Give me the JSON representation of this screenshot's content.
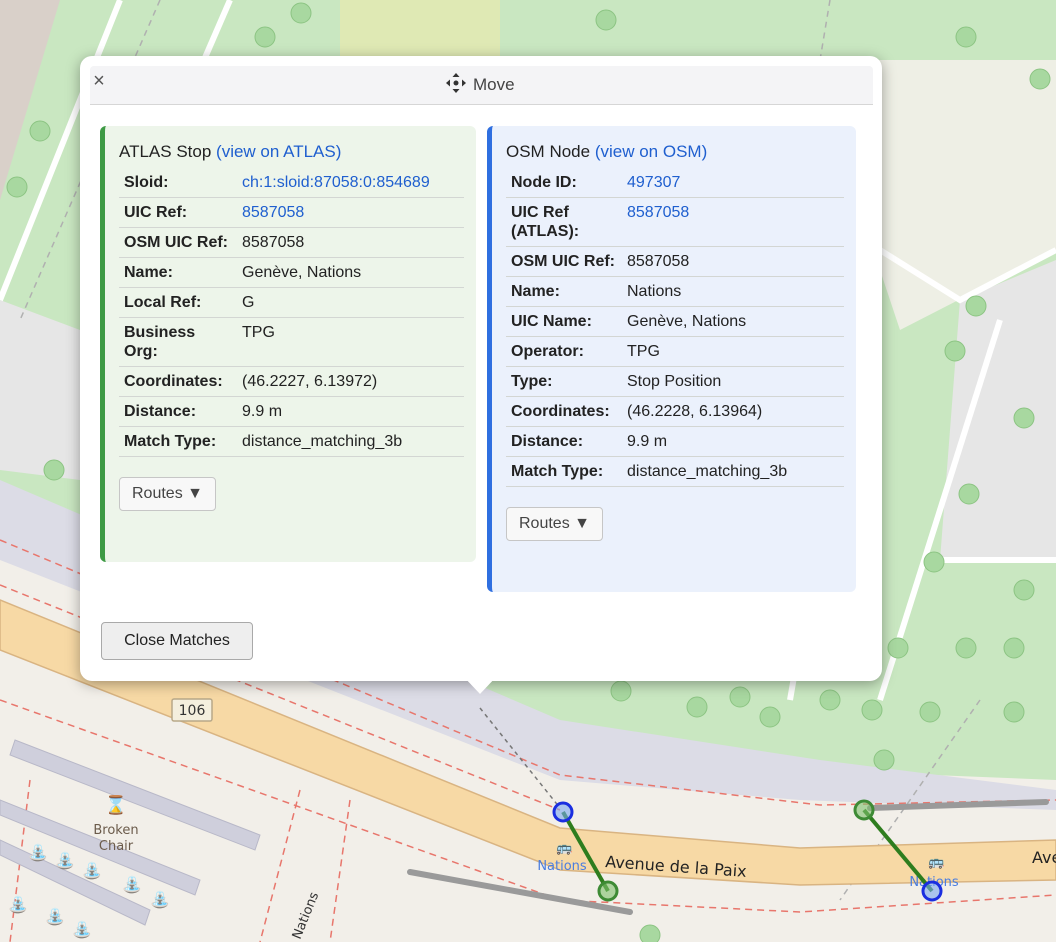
{
  "map": {
    "road_name": "Avenue de la Paix",
    "road_number": "106",
    "stop_label_1": "Nations",
    "stop_label_2": "Nations",
    "side_street": "Nations",
    "poi_label_line1": "Broken",
    "poi_label_line2": "Chair",
    "colors": {
      "park": "#c8e6c0",
      "road": "#f7d8a4",
      "land": "#f2efe9",
      "atlas_marker": "#3e8b35",
      "osm_marker": "#1a2ee0",
      "match_line": "#2e7d1e"
    }
  },
  "popup": {
    "close_symbol": "×",
    "move_label": "Move",
    "atlas": {
      "title": "ATLAS Stop",
      "link": "(view on ATLAS)",
      "rows": [
        {
          "key": "Sloid:",
          "value": "ch:1:sloid:87058:0:854689",
          "link": true
        },
        {
          "key": "UIC Ref:",
          "value": "8587058",
          "link": true
        },
        {
          "key": "OSM UIC Ref:",
          "value": "8587058",
          "link": false
        },
        {
          "key": "Name:",
          "value": "Genève, Nations",
          "link": false
        },
        {
          "key": "Local Ref:",
          "value": "G",
          "link": false
        },
        {
          "key": "Business Org:",
          "value": "TPG",
          "link": false
        },
        {
          "key": "Coordinates:",
          "value": "(46.2227, 6.13972)",
          "link": false
        },
        {
          "key": "Distance:",
          "value": "9.9 m",
          "link": false
        },
        {
          "key": "Match Type:",
          "value": "distance_matching_3b",
          "link": false
        }
      ],
      "routes_button": "Routes ▼"
    },
    "osm": {
      "title": "OSM Node",
      "link": "(view on OSM)",
      "rows": [
        {
          "key": "Node ID:",
          "value": "497307",
          "link": true
        },
        {
          "key": "UIC Ref (ATLAS):",
          "value": "8587058",
          "link": true
        },
        {
          "key": "OSM UIC Ref:",
          "value": "8587058",
          "link": false
        },
        {
          "key": "Name:",
          "value": "Nations",
          "link": false
        },
        {
          "key": "UIC Name:",
          "value": "Genève, Nations",
          "link": false
        },
        {
          "key": "Operator:",
          "value": "TPG",
          "link": false
        },
        {
          "key": "Type:",
          "value": "Stop Position",
          "link": false
        },
        {
          "key": "Coordinates:",
          "value": "(46.2228, 6.13964)",
          "link": false
        },
        {
          "key": "Distance:",
          "value": "9.9 m",
          "link": false
        },
        {
          "key": "Match Type:",
          "value": "distance_matching_3b",
          "link": false
        }
      ],
      "routes_button": "Routes ▼"
    },
    "close_matches_button": "Close Matches"
  }
}
